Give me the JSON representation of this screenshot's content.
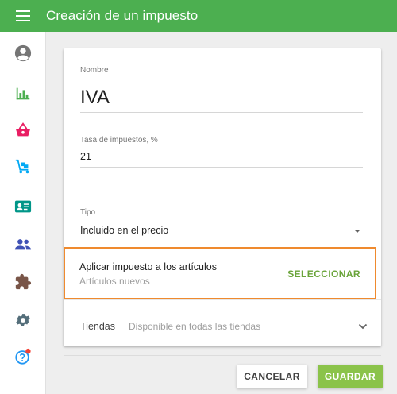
{
  "header": {
    "title": "Creación de un impuesto"
  },
  "sidebar": {
    "items": [
      {
        "icon": "account-circle-icon",
        "color": "#757575"
      },
      {
        "icon": "bar-chart-icon",
        "color": "#4caf50"
      },
      {
        "icon": "basket-icon",
        "color": "#e91e63"
      },
      {
        "icon": "cart-icon",
        "color": "#03a9f4"
      },
      {
        "icon": "id-card-icon",
        "color": "#009688"
      },
      {
        "icon": "people-icon",
        "color": "#3f51b5"
      },
      {
        "icon": "puzzle-icon",
        "color": "#795548"
      },
      {
        "icon": "gear-icon",
        "color": "#546e7a"
      },
      {
        "icon": "help-icon",
        "color": "#2196f3"
      }
    ]
  },
  "form": {
    "name_label": "Nombre",
    "name_value": "IVA",
    "rate_label": "Tasa de impuestos, %",
    "rate_value": "21",
    "type_label": "Tipo",
    "type_value": "Incluido en el precio",
    "apply": {
      "title": "Aplicar impuesto a los artículos",
      "subtitle": "Artículos nuevos",
      "select_label": "SELECCIONAR"
    },
    "stores": {
      "label": "Tiendas",
      "value": "Disponible en todas las tiendas"
    }
  },
  "actions": {
    "cancel_label": "CANCELAR",
    "save_label": "GUARDAR"
  },
  "colors": {
    "primary": "#4caf50",
    "accent": "#8bc34a",
    "highlight": "#ef8a2e",
    "link": "#6aa43a"
  }
}
